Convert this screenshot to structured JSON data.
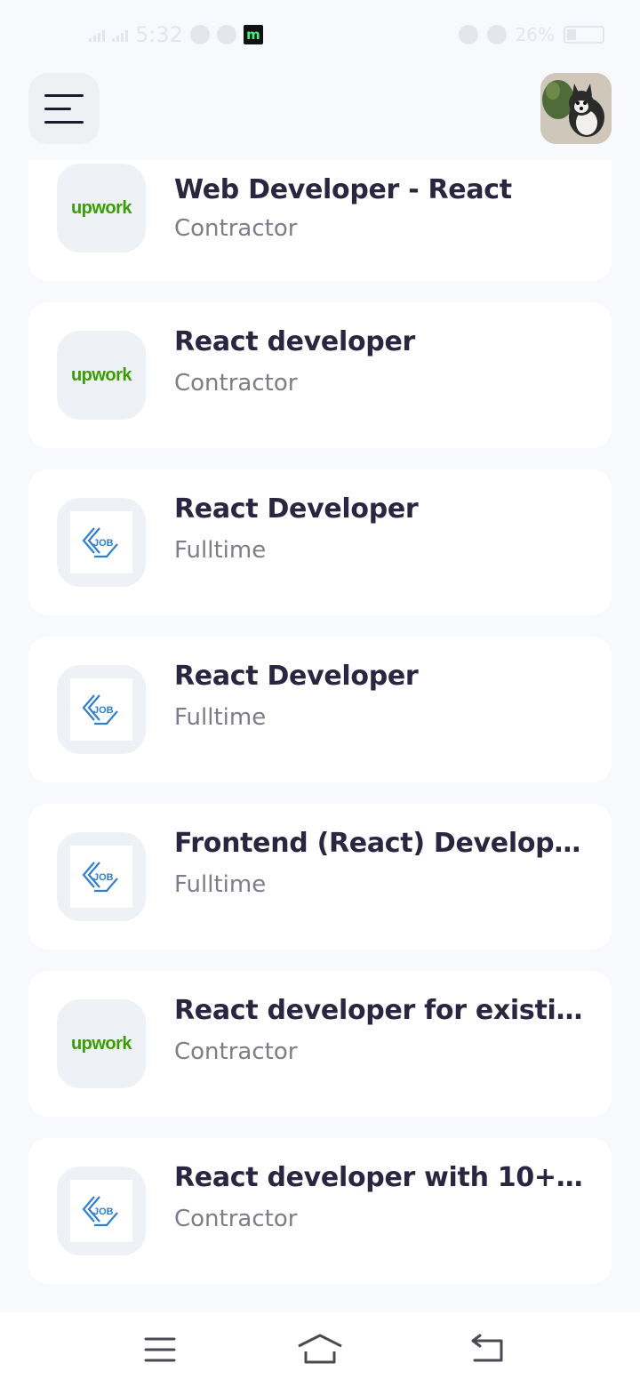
{
  "status_bar": {
    "time": "5:32",
    "battery": "26%",
    "app_badge": "m"
  },
  "header": {
    "menu_icon": "hamburger-menu-icon",
    "avatar": "user-avatar-puppy-photo"
  },
  "jobs": [
    {
      "title": "Web Developer - React",
      "type": "Contractor",
      "logo": "upwork",
      "logo_text": "upwork"
    },
    {
      "title": "React developer",
      "type": "Contractor",
      "logo": "upwork",
      "logo_text": "upwork"
    },
    {
      "title": "React Developer",
      "type": "Fulltime",
      "logo": "job",
      "logo_text": "JOB"
    },
    {
      "title": "React Developer",
      "type": "Fulltime",
      "logo": "job",
      "logo_text": "JOB"
    },
    {
      "title": "Frontend (React) Develop...",
      "type": "Fulltime",
      "logo": "job",
      "logo_text": "JOB"
    },
    {
      "title": "React developer for existi...",
      "type": "Contractor",
      "logo": "upwork",
      "logo_text": "upwork"
    },
    {
      "title": "React developer with 10+...",
      "type": "Contractor",
      "logo": "job",
      "logo_text": "JOB"
    }
  ],
  "nav": {
    "menu_icon": "recent-apps-icon",
    "home_icon": "home-icon",
    "back_icon": "back-icon"
  },
  "colors": {
    "background": "#f8f9fc",
    "card": "#ffffff",
    "title": "#2a2540",
    "subtitle": "#7e7c89",
    "upwork_green": "#37a000",
    "job_blue": "#2f7fd0"
  }
}
